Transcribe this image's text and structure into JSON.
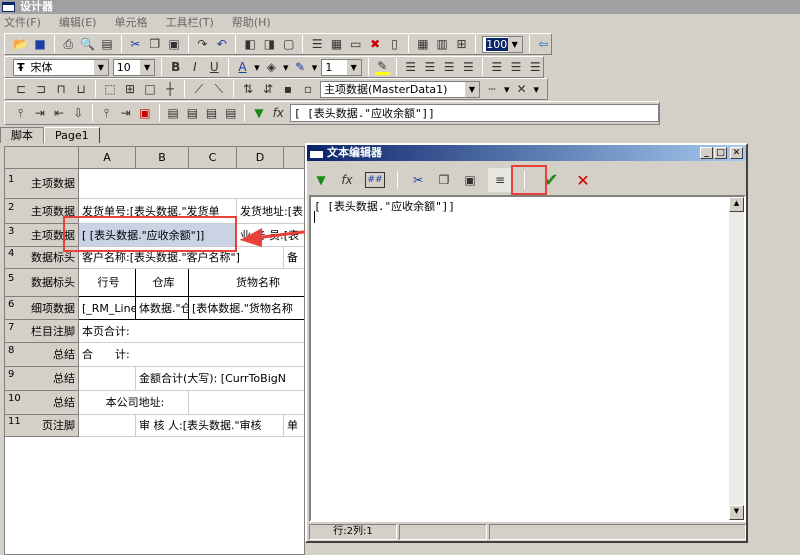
{
  "window": {
    "title": "设计器"
  },
  "menu": [
    "文件(F)",
    "编辑(E)",
    "单元格",
    "工具栏(T)",
    "帮助(H)"
  ],
  "toolbar": {
    "font_name": "宋体",
    "font_size": "10",
    "line_width": "1",
    "zoom": "100%",
    "dataset": "主项数据(MasterData1)",
    "formula": "[ [表头数据.\"应收余额\"]]"
  },
  "tabs": [
    "脚本",
    "Page1"
  ],
  "grid": {
    "columns": [
      "A",
      "B",
      "C",
      "D"
    ],
    "rows": [
      {
        "num": "1",
        "band": "主项数据",
        "cells": []
      },
      {
        "num": "2",
        "band": "主项数据",
        "cells": [
          "发货单号:[表头数据.\"发货单",
          "发货地址:[表"
        ]
      },
      {
        "num": "3",
        "band": "主项数据",
        "cells": [
          "[ [表头数据.\"应收余额\"]]",
          "业 务 员:[表"
        ]
      },
      {
        "num": "4",
        "band": "数据标头",
        "cells": [
          "客户名称:[表头数据.\"客户名称\"]",
          "备"
        ]
      },
      {
        "num": "5",
        "band": "数据标头",
        "cells": [
          "行号",
          "仓库",
          "货物名称"
        ]
      },
      {
        "num": "6",
        "band": "细项数据",
        "cells": [
          "[_RM_Line",
          "体数据.\"仓",
          "[表体数据.\"货物名称"
        ]
      },
      {
        "num": "7",
        "band": "栏目注脚",
        "cells": [
          "本页合计:"
        ]
      },
      {
        "num": "8",
        "band": "总结",
        "cells": [
          "合　　计:"
        ]
      },
      {
        "num": "9",
        "band": "总结",
        "cells": [
          "金额合计(大写): [CurrToBigN"
        ]
      },
      {
        "num": "10",
        "band": "总结",
        "cells": [
          "本公司地址:",
          "["
        ]
      },
      {
        "num": "11",
        "band": "页注脚",
        "cells": [
          "审 核 人:[表头数据.\"审核",
          "单"
        ]
      }
    ]
  },
  "editor": {
    "title": "文本编辑器",
    "text": "[ [表头数据.\"应收余额\"]]",
    "status": "行:2列:1",
    "ok_icon": "check-icon",
    "cancel_icon": "close-icon"
  },
  "colors": {
    "highlight": "#e8413a",
    "selection": "#c9d3e3",
    "ok": "#1a8a1a"
  }
}
